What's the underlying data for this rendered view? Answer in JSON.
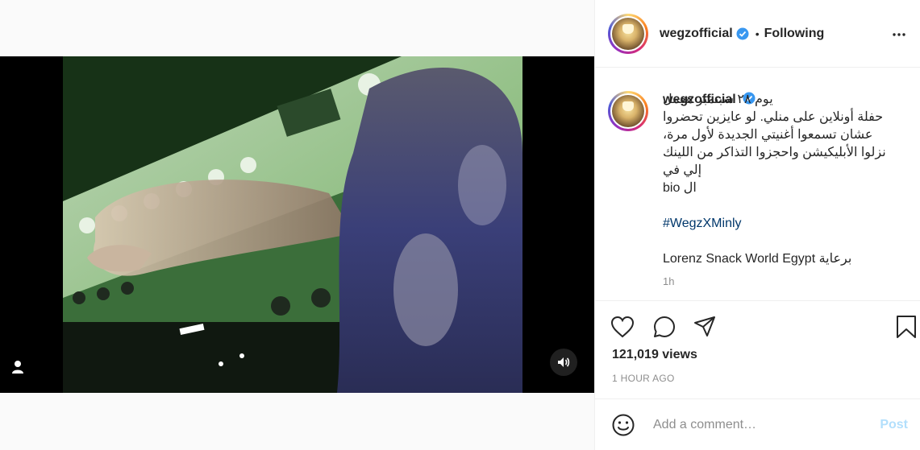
{
  "post": {
    "username": "wegzofficial",
    "following_label": "Following",
    "separator": "•",
    "caption": "يوم ٢٨ سبتمبر هعمل\nحفلة أونلاين على منلي. لو عايزين تحضروا\nعشان تسمعوا أغنيتي الجديدة لأول مرة،\nنزلوا الأبليكيشن واحجزوا التذاكر من اللينك\nإلي في\nال bio",
    "hashtag": "#WegzXMinly",
    "sponsor_line": "برعاية Lorenz Snack World Egypt",
    "caption_time": "1h",
    "views": "121,019 views",
    "age": "1 HOUR AGO"
  },
  "comment": {
    "placeholder": "Add a comment…",
    "post_label": "Post"
  },
  "icons": {
    "verified": "verified-badge-icon",
    "more": "more-options-icon",
    "like": "heart-icon",
    "comment": "comment-bubble-icon",
    "share": "paper-plane-icon",
    "save": "bookmark-icon",
    "emoji": "smiley-icon",
    "mute": "speaker-icon",
    "user_tag": "user-icon"
  },
  "colors": {
    "verified_blue": "#3897f0",
    "link": "#00376b",
    "post_disabled": "#b2dffc",
    "muted": "#8e8e8e"
  }
}
